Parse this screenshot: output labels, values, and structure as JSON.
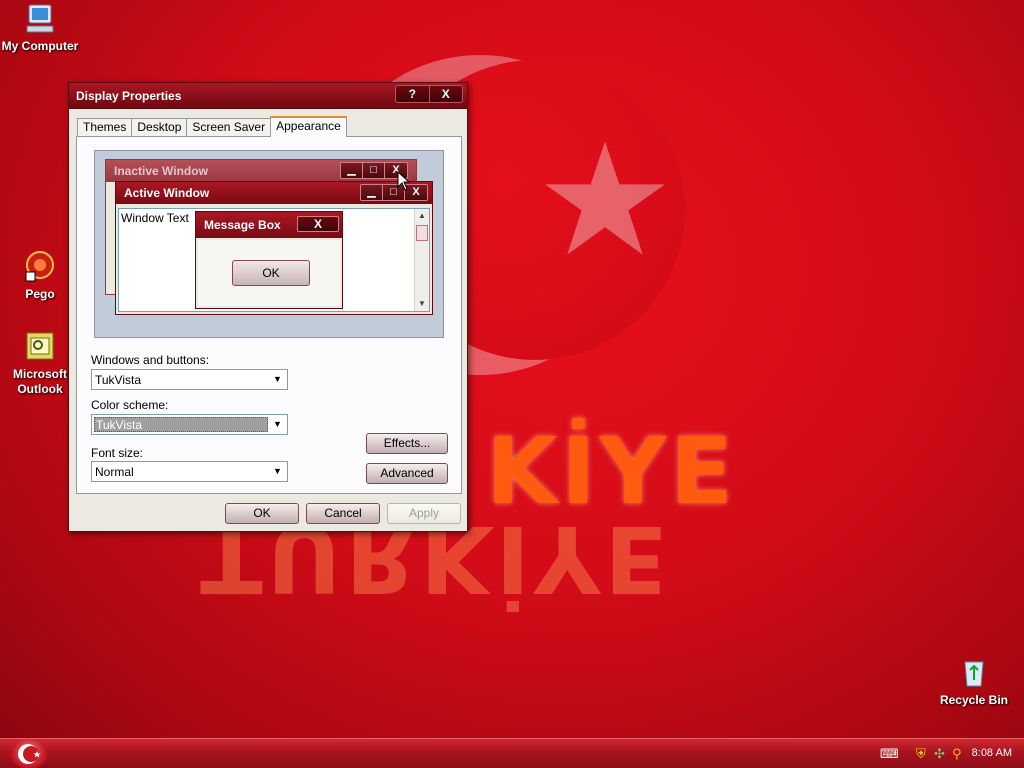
{
  "desktop": {
    "wallpaper_text": "KİYE",
    "wallpaper_reflection": "TURKİYE",
    "icons": {
      "my_computer": "My Computer",
      "pego": "Pego",
      "outlook": "Microsoft Outlook",
      "recycle_bin": "Recycle Bin"
    }
  },
  "window": {
    "title": "Display Properties",
    "help_btn": "?",
    "close_btn": "X",
    "tabs": [
      "Themes",
      "Desktop",
      "Screen Saver",
      "Appearance"
    ],
    "active_tab": "Appearance",
    "preview": {
      "inactive_title": "Inactive Window",
      "active_title": "Active Window",
      "window_text": "Window Text",
      "message_title": "Message Box",
      "message_ok": "OK",
      "close_glyph": "X"
    },
    "windows_buttons_label": "Windows and buttons:",
    "windows_buttons_value": "TukVista",
    "color_scheme_label": "Color scheme:",
    "color_scheme_value": "TukVista",
    "font_size_label": "Font size:",
    "font_size_value": "Normal",
    "effects_btn": "Effects...",
    "advanced_btn": "Advanced",
    "ok_btn": "OK",
    "cancel_btn": "Cancel",
    "apply_btn": "Apply"
  },
  "taskbar": {
    "clock": "8:08 AM"
  },
  "colors": {
    "desktop_red": "#d20c18",
    "titlebar_red": "#8a0e18",
    "tab_highlight": "#e68b2c"
  }
}
